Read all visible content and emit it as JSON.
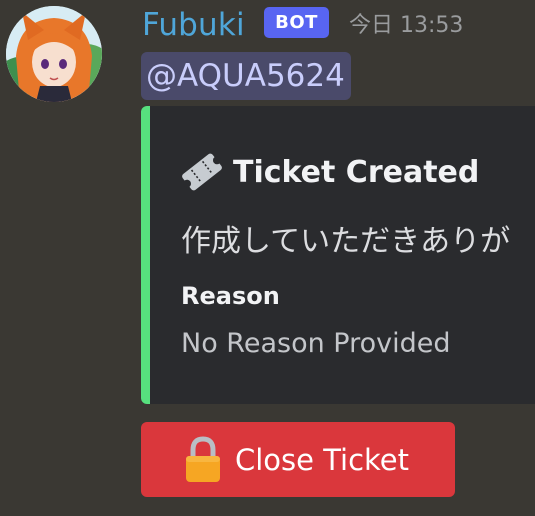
{
  "message": {
    "author": {
      "name": "Fubuki",
      "badge": "BOT",
      "avatar_icon": "avatar-fox-girl"
    },
    "timestamp": "今日 13:53",
    "mention": "@AQUA5624"
  },
  "embed": {
    "accent_color": "#57e07e",
    "title_icon": "ticket-icon",
    "title": "Ticket Created",
    "description": "作成していただきありが",
    "fields": [
      {
        "name": "Reason",
        "value": "No Reason Provided"
      }
    ]
  },
  "actions": {
    "close_button": {
      "icon": "lock-icon",
      "label": "Close Ticket",
      "color": "#da373c"
    }
  },
  "colors": {
    "username": "#4fa6d9",
    "badge": "#5865f2",
    "mention_bg": "#4a4a6a"
  }
}
